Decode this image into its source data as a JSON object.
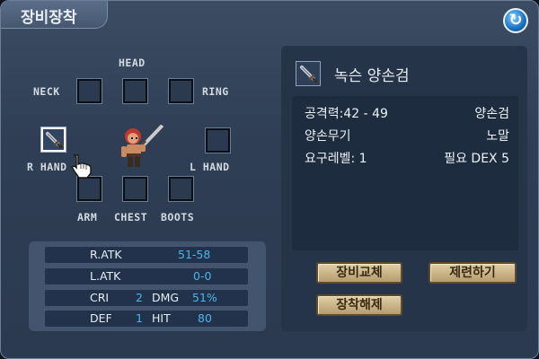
{
  "window": {
    "title": "장비장착",
    "refresh_icon": "refresh-icon"
  },
  "slots": {
    "head": "HEAD",
    "neck": "NECK",
    "ring": "RING",
    "r_hand": "R HAND",
    "l_hand": "L HAND",
    "arm": "ARM",
    "chest": "CHEST",
    "boots": "BOOTS"
  },
  "stats": {
    "ratk": {
      "label": "R.ATK",
      "value": "51-58"
    },
    "latk": {
      "label": "L.ATK",
      "value": "0-0"
    },
    "cri": {
      "label": "CRI",
      "value": "2"
    },
    "dmg": {
      "label": "DMG",
      "value": "51%"
    },
    "def": {
      "label": "DEF",
      "value": "1"
    },
    "hit": {
      "label": "HIT",
      "value": "80"
    }
  },
  "item": {
    "name": "녹슨 양손검",
    "info": [
      {
        "left": "공격력:42 - 49",
        "right": "양손검"
      },
      {
        "left": "양손무기",
        "right": "노말"
      },
      {
        "left": "요구레벨: 1",
        "right": "필요 DEX 5"
      }
    ]
  },
  "buttons": {
    "swap": "장비교체",
    "refine": "제련하기",
    "unequip": "장착해제"
  },
  "colors": {
    "stat_value": "#48b8ea",
    "button": "#c9b58a",
    "panel": "#253448"
  }
}
